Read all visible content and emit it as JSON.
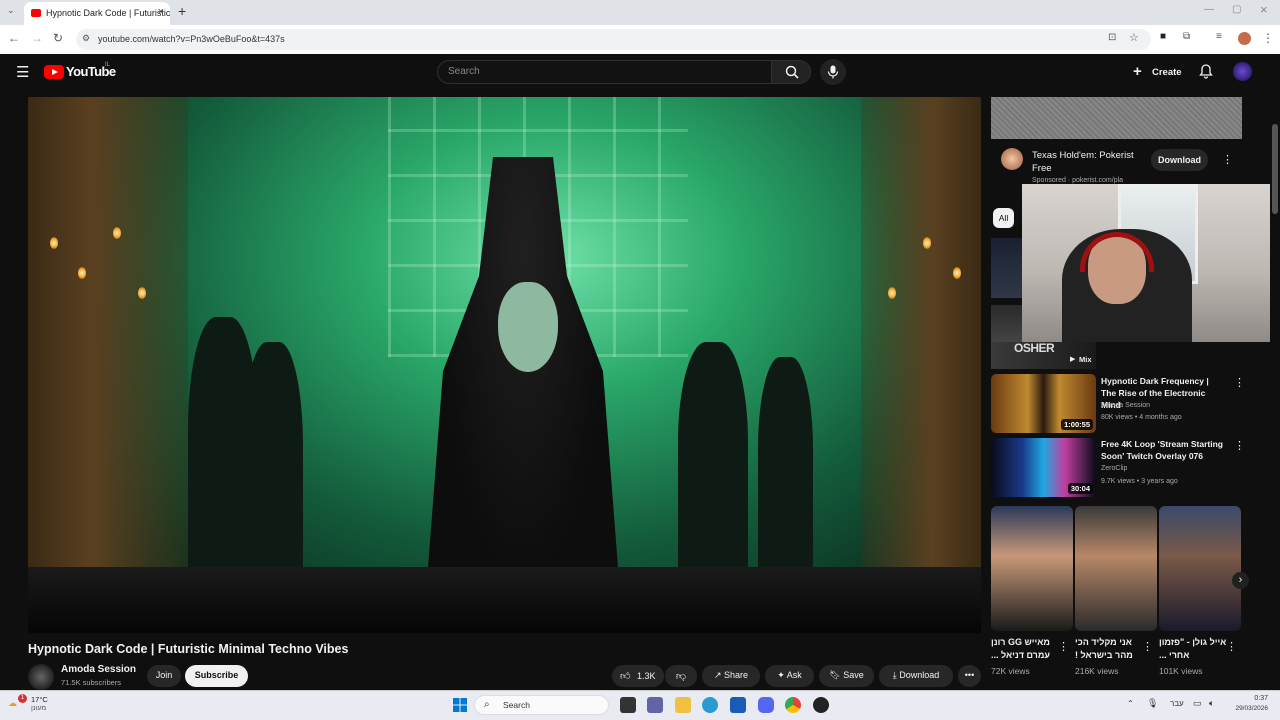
{
  "browser": {
    "tab_title": "Hypnotic Dark Code | Futuristic",
    "url": "youtube.com/watch?v=Pn3wOeBuFoo&t=437s"
  },
  "youtube": {
    "logo_text": "YouTube",
    "logo_country": "IL",
    "search_placeholder": "Search",
    "create_label": "Create"
  },
  "video": {
    "title": "Hypnotic Dark Code | Futuristic Minimal Techno Vibes",
    "channel": "Amoda Session",
    "subscribers": "71.5K subscribers",
    "join_label": "Join",
    "subscribe_label": "Subscribe",
    "likes": "1.3K",
    "share_label": "Share",
    "ask_label": "Ask",
    "save_label": "Save",
    "download_label": "Download"
  },
  "ad": {
    "title": "Texas Hold'em: Pokerist Free",
    "sponsored": "Sponsored · pokerist.com/pla",
    "button_label": "Download"
  },
  "chips": {
    "all_label": "All"
  },
  "mix": {
    "overlay_text": "OSHER",
    "label": "Mix"
  },
  "recommended": [
    {
      "title": "Hypnotic Dark Frequency | The Rise of the Electronic Mind",
      "channel": "Amoda Session",
      "meta": "80K views • 4 months ago",
      "duration": "1:00:55"
    },
    {
      "title": "Free 4K Loop 'Stream Starting Soon' Twitch Overlay 076",
      "channel": "ZeroClip",
      "meta": "9.7K views • 3 years ago",
      "duration": "30:04"
    }
  ],
  "shorts": [
    {
      "title": "מאייש GG רונן עמרם דניאל ...",
      "views": "72K views"
    },
    {
      "title": "אני מקליד הכי מהר בישראל !",
      "views": "216K views"
    },
    {
      "title": "אייל גולן - \"פזמון אחרי ...",
      "views": "101K views"
    }
  ],
  "taskbar": {
    "weather_temp": "17°C",
    "weather_label": "מעונן",
    "notification_badge": "1",
    "search_label": "Search",
    "language": "עבר",
    "time": "0:37",
    "date": "29/03/2026"
  },
  "colors": {
    "yt_bg": "#0f0f0f",
    "yt_red": "#ff0000",
    "chip_active": "#f1f1f1",
    "taskbar": "#e8ecf2"
  }
}
